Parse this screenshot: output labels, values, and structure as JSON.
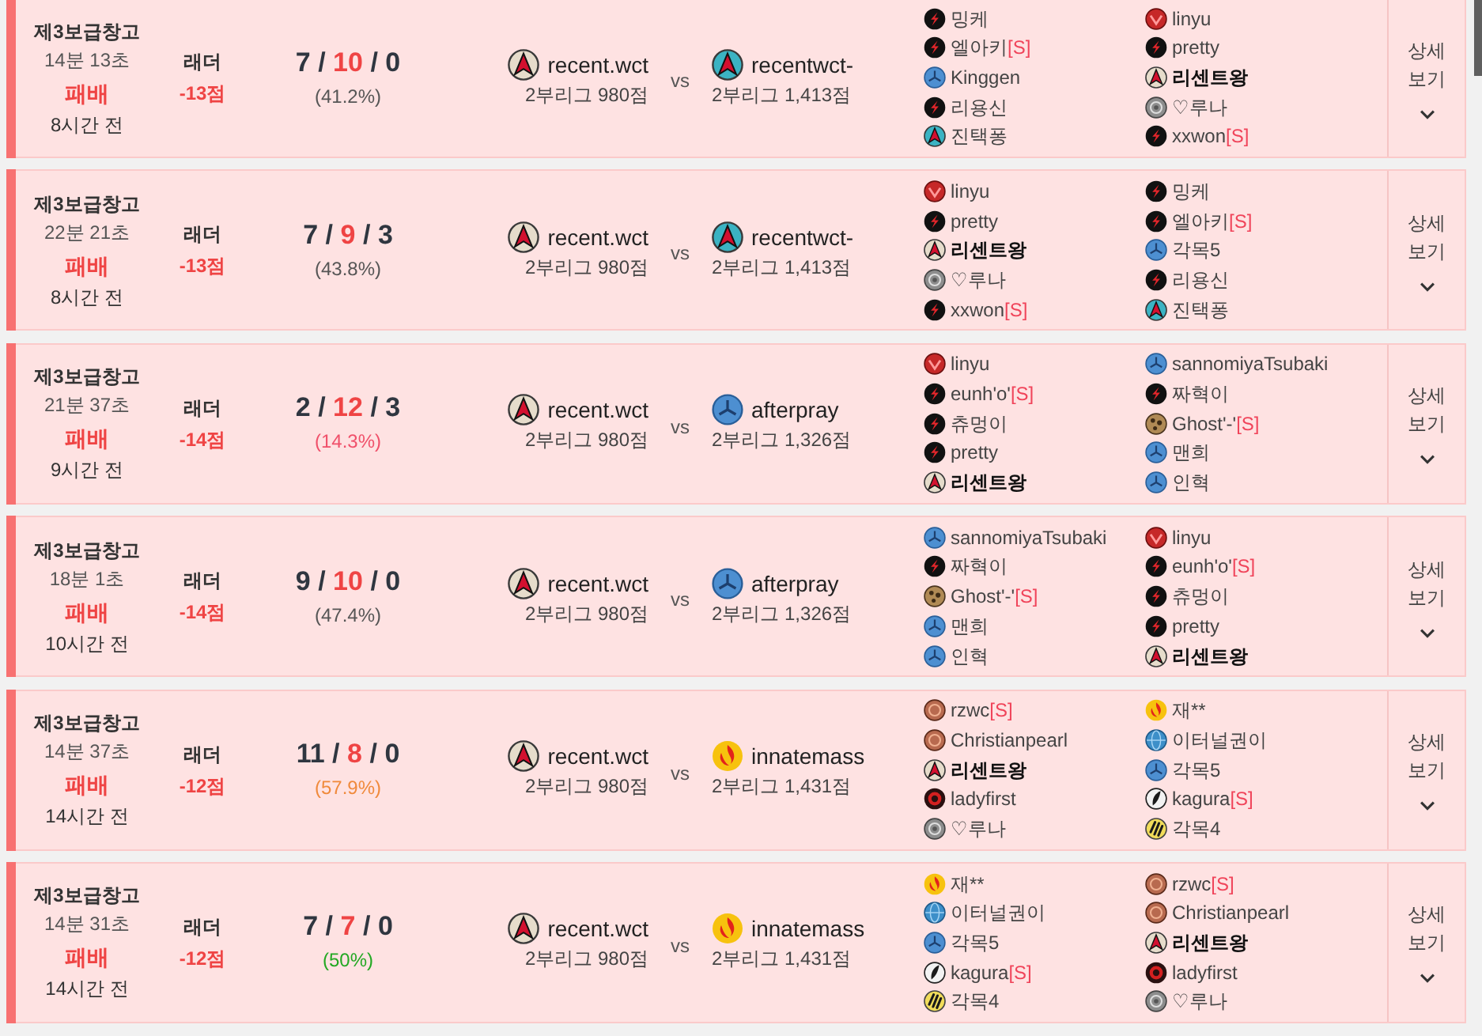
{
  "matches": [
    {
      "won": false,
      "map": "제3보급창고",
      "duration": "14분 13초",
      "result": "패배",
      "time_ago": "8시간 전",
      "game_type": "래더",
      "points": "-13점",
      "kda": [
        {
          "kind": "kills",
          "text": "7"
        },
        {
          "kind": "separator",
          "text": "/"
        },
        {
          "kind": "deaths",
          "text": "10"
        },
        {
          "kind": "separator",
          "text": "/"
        },
        {
          "kind": "assists",
          "text": "0"
        }
      ],
      "kda_ratio": {
        "text": "(41.2%)",
        "color": "#555555"
      },
      "my_team": {
        "name": "recent.wct",
        "league": "2부리그 980점",
        "kind": "star"
      },
      "vs": "vs",
      "opponent_team": {
        "name": "recentwct-",
        "league": "2부리그 1,413점",
        "kind": "tealstar"
      },
      "player_lists": [
        [
          {
            "name": "밍케",
            "kind": "bolt",
            "current_user": false
          },
          {
            "name": "엘아키",
            "tag": "[S]",
            "kind": "bolt",
            "current_user": false
          },
          {
            "name": "Kinggen",
            "kind": "triblade",
            "current_user": false
          },
          {
            "name": "리용신",
            "kind": "bolt",
            "current_user": false
          },
          {
            "name": "진택퐁",
            "kind": "tealstar",
            "current_user": false
          }
        ],
        [
          {
            "name": "linyu",
            "kind": "chevron",
            "current_user": false
          },
          {
            "name": "pretty",
            "kind": "bolt",
            "current_user": false
          },
          {
            "name": "리센트왕",
            "kind": "star",
            "current_user": true
          },
          {
            "name": "♡루나",
            "kind": "swirl",
            "current_user": false
          },
          {
            "name": "xxwon",
            "tag": "[S]",
            "kind": "bolt",
            "current_user": false
          }
        ]
      ],
      "detail_button": "상세 보기"
    },
    {
      "won": false,
      "map": "제3보급창고",
      "duration": "22분 21초",
      "result": "패배",
      "time_ago": "8시간 전",
      "game_type": "래더",
      "points": "-13점",
      "kda": [
        {
          "kind": "kills",
          "text": "7"
        },
        {
          "kind": "separator",
          "text": "/"
        },
        {
          "kind": "deaths",
          "text": "9"
        },
        {
          "kind": "separator",
          "text": "/"
        },
        {
          "kind": "assists",
          "text": "3"
        }
      ],
      "kda_ratio": {
        "text": "(43.8%)",
        "color": "#555555"
      },
      "my_team": {
        "name": "recent.wct",
        "league": "2부리그 980점",
        "kind": "star"
      },
      "vs": "vs",
      "opponent_team": {
        "name": "recentwct-",
        "league": "2부리그 1,413점",
        "kind": "tealstar"
      },
      "player_lists": [
        [
          {
            "name": "linyu",
            "kind": "chevron",
            "current_user": false
          },
          {
            "name": "pretty",
            "kind": "bolt",
            "current_user": false
          },
          {
            "name": "리센트왕",
            "kind": "star",
            "current_user": true
          },
          {
            "name": "♡루나",
            "kind": "swirl",
            "current_user": false
          },
          {
            "name": "xxwon",
            "tag": "[S]",
            "kind": "bolt",
            "current_user": false
          }
        ],
        [
          {
            "name": "밍케",
            "kind": "bolt",
            "current_user": false
          },
          {
            "name": "엘아키",
            "tag": "[S]",
            "kind": "bolt",
            "current_user": false
          },
          {
            "name": "각목5",
            "kind": "triblade",
            "current_user": false
          },
          {
            "name": "리용신",
            "kind": "bolt",
            "current_user": false
          },
          {
            "name": "진택퐁",
            "kind": "tealstar",
            "current_user": false
          }
        ]
      ],
      "detail_button": "상세 보기"
    },
    {
      "won": false,
      "map": "제3보급창고",
      "duration": "21분 37초",
      "result": "패배",
      "time_ago": "9시간 전",
      "game_type": "래더",
      "points": "-14점",
      "kda": [
        {
          "kind": "kills",
          "text": "2"
        },
        {
          "kind": "separator",
          "text": "/"
        },
        {
          "kind": "deaths",
          "text": "12"
        },
        {
          "kind": "separator",
          "text": "/"
        },
        {
          "kind": "assists",
          "text": "3"
        }
      ],
      "kda_ratio": {
        "text": "(14.3%)",
        "color": "#f0506a"
      },
      "my_team": {
        "name": "recent.wct",
        "league": "2부리그 980점",
        "kind": "star"
      },
      "vs": "vs",
      "opponent_team": {
        "name": "afterpray",
        "league": "2부리그 1,326점",
        "kind": "triblade"
      },
      "player_lists": [
        [
          {
            "name": "linyu",
            "kind": "chevron",
            "current_user": false
          },
          {
            "name": "eunh'o'",
            "tag": "[S]",
            "kind": "bolt",
            "current_user": false
          },
          {
            "name": "츄멍이",
            "kind": "bolt",
            "current_user": false
          },
          {
            "name": "pretty",
            "kind": "bolt",
            "current_user": false
          },
          {
            "name": "리센트왕",
            "kind": "star",
            "current_user": true
          }
        ],
        [
          {
            "name": "sannomiyaTsubaki",
            "kind": "triblade",
            "current_user": false
          },
          {
            "name": "짜혁이",
            "kind": "bolt",
            "current_user": false
          },
          {
            "name": "Ghost'-'",
            "tag": "[S]",
            "kind": "spotted",
            "current_user": false
          },
          {
            "name": "맨희",
            "kind": "triblade",
            "current_user": false
          },
          {
            "name": "인혁",
            "kind": "triblade",
            "current_user": false
          }
        ]
      ],
      "detail_button": "상세 보기"
    },
    {
      "won": false,
      "map": "제3보급창고",
      "duration": "18분 1초",
      "result": "패배",
      "time_ago": "10시간 전",
      "game_type": "래더",
      "points": "-14점",
      "kda": [
        {
          "kind": "kills",
          "text": "9"
        },
        {
          "kind": "separator",
          "text": "/"
        },
        {
          "kind": "deaths",
          "text": "10"
        },
        {
          "kind": "separator",
          "text": "/"
        },
        {
          "kind": "assists",
          "text": "0"
        }
      ],
      "kda_ratio": {
        "text": "(47.4%)",
        "color": "#555555"
      },
      "my_team": {
        "name": "recent.wct",
        "league": "2부리그 980점",
        "kind": "star"
      },
      "vs": "vs",
      "opponent_team": {
        "name": "afterpray",
        "league": "2부리그 1,326점",
        "kind": "triblade"
      },
      "player_lists": [
        [
          {
            "name": "sannomiyaTsubaki",
            "kind": "triblade",
            "current_user": false
          },
          {
            "name": "짜혁이",
            "kind": "bolt",
            "current_user": false
          },
          {
            "name": "Ghost'-'",
            "tag": "[S]",
            "kind": "spotted",
            "current_user": false
          },
          {
            "name": "맨희",
            "kind": "triblade",
            "current_user": false
          },
          {
            "name": "인혁",
            "kind": "triblade",
            "current_user": false
          }
        ],
        [
          {
            "name": "linyu",
            "kind": "chevron",
            "current_user": false
          },
          {
            "name": "eunh'o'",
            "tag": "[S]",
            "kind": "bolt",
            "current_user": false
          },
          {
            "name": "츄멍이",
            "kind": "bolt",
            "current_user": false
          },
          {
            "name": "pretty",
            "kind": "bolt",
            "current_user": false
          },
          {
            "name": "리센트왕",
            "kind": "star",
            "current_user": true
          }
        ]
      ],
      "detail_button": "상세 보기"
    },
    {
      "won": false,
      "map": "제3보급창고",
      "duration": "14분 37초",
      "result": "패배",
      "time_ago": "14시간 전",
      "game_type": "래더",
      "points": "-12점",
      "kda": [
        {
          "kind": "kills",
          "text": "11"
        },
        {
          "kind": "separator",
          "text": "/"
        },
        {
          "kind": "deaths",
          "text": "8"
        },
        {
          "kind": "separator",
          "text": "/"
        },
        {
          "kind": "assists",
          "text": "0"
        }
      ],
      "kda_ratio": {
        "text": "(57.9%)",
        "color": "#f08a3c"
      },
      "my_team": {
        "name": "recent.wct",
        "league": "2부리그 980점",
        "kind": "star"
      },
      "vs": "vs",
      "opponent_team": {
        "name": "innatemass",
        "league": "2부리그 1,431점",
        "kind": "flame"
      },
      "player_lists": [
        [
          {
            "name": "rzwc",
            "tag": "[S]",
            "kind": "ring",
            "current_user": false
          },
          {
            "name": "Christianpearl",
            "kind": "ring",
            "current_user": false
          },
          {
            "name": "리센트왕",
            "kind": "star",
            "current_user": true
          },
          {
            "name": "ladyfirst",
            "kind": "target",
            "current_user": false
          },
          {
            "name": "♡루나",
            "kind": "swirl",
            "current_user": false
          }
        ],
        [
          {
            "name": "재**",
            "kind": "flame",
            "current_user": false
          },
          {
            "name": "이터널권이",
            "kind": "globe",
            "current_user": false
          },
          {
            "name": "각목5",
            "kind": "triblade",
            "current_user": false
          },
          {
            "name": "kagura",
            "tag": "[S]",
            "kind": "feather",
            "current_user": false
          },
          {
            "name": "각목4",
            "kind": "claw",
            "current_user": false
          }
        ]
      ],
      "detail_button": "상세 보기"
    },
    {
      "won": false,
      "map": "제3보급창고",
      "duration": "14분 31초",
      "result": "패배",
      "time_ago": "14시간 전",
      "game_type": "래더",
      "points": "-12점",
      "kda": [
        {
          "kind": "kills",
          "text": "7"
        },
        {
          "kind": "separator",
          "text": "/"
        },
        {
          "kind": "deaths",
          "text": "7"
        },
        {
          "kind": "separator",
          "text": "/"
        },
        {
          "kind": "assists",
          "text": "0"
        }
      ],
      "kda_ratio": {
        "text": "(50%)",
        "color": "#22a822"
      },
      "my_team": {
        "name": "recent.wct",
        "league": "2부리그 980점",
        "kind": "star"
      },
      "vs": "vs",
      "opponent_team": {
        "name": "innatemass",
        "league": "2부리그 1,431점",
        "kind": "flame"
      },
      "player_lists": [
        [
          {
            "name": "재**",
            "kind": "flame",
            "current_user": false
          },
          {
            "name": "이터널권이",
            "kind": "globe",
            "current_user": false
          },
          {
            "name": "각목5",
            "kind": "triblade",
            "current_user": false
          },
          {
            "name": "kagura",
            "tag": "[S]",
            "kind": "feather",
            "current_user": false
          },
          {
            "name": "각목4",
            "kind": "claw",
            "current_user": false
          }
        ],
        [
          {
            "name": "rzwc",
            "tag": "[S]",
            "kind": "ring",
            "current_user": false
          },
          {
            "name": "Christianpearl",
            "kind": "ring",
            "current_user": false
          },
          {
            "name": "리센트왕",
            "kind": "star",
            "current_user": true
          },
          {
            "name": "ladyfirst",
            "kind": "target",
            "current_user": false
          },
          {
            "name": "♡루나",
            "kind": "swirl",
            "current_user": false
          }
        ]
      ],
      "detail_button": "상세 보기"
    }
  ]
}
